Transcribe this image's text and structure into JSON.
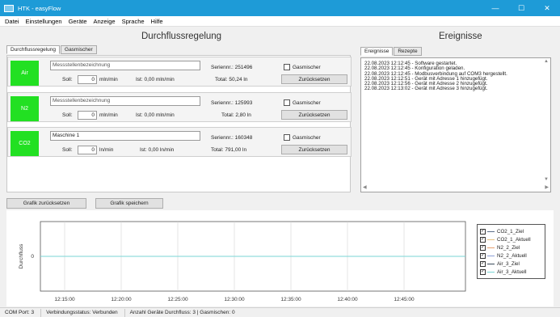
{
  "window": {
    "title": "HTK - easyFlow",
    "icon": "app-icon",
    "minimize_glyph": "—",
    "maximize_glyph": "☐",
    "close_glyph": "✕"
  },
  "menu": [
    "Datei",
    "Einstellungen",
    "Geräte",
    "Anzeige",
    "Sprache",
    "Hilfe"
  ],
  "flow": {
    "title": "Durchflussregelung",
    "tabs": [
      {
        "label": "Durchflussregelung",
        "active": true
      },
      {
        "label": "Gasmischer",
        "active": false
      }
    ],
    "devices": [
      {
        "name": "Air",
        "placeholder": "Messstellenbezeichnung",
        "soll_label": "Soll:",
        "soll_value": "0",
        "soll_unit": "mln/min",
        "ist": "Ist: 0,00 mln/min",
        "serial": "Seriennr.: 251496",
        "gasmischer": "Gasmischer",
        "total": "Total: 50,24 ln",
        "reset": "Zurücksetzen",
        "color": "#22e022"
      },
      {
        "name": "N2",
        "placeholder": "Messstellenbezeichnung",
        "soll_label": "Soll:",
        "soll_value": "0",
        "soll_unit": "mln/min",
        "ist": "Ist: 0,00 mln/min",
        "serial": "Seriennr.: 125993",
        "gasmischer": "Gasmischer",
        "total": "Total: 2,80 ln",
        "reset": "Zurücksetzen",
        "color": "#22e022"
      },
      {
        "name": "CO2",
        "placeholder": "Maschine 1",
        "soll_label": "Soll:",
        "soll_value": "0",
        "soll_unit": "ln/min",
        "ist": "Ist: 0,00 ln/min",
        "serial": "Seriennr.: 160348",
        "gasmischer": "Gasmischer",
        "total": "Total: 791,00 ln",
        "reset": "Zurücksetzen",
        "color": "#22e022"
      }
    ]
  },
  "events": {
    "title": "Ereignisse",
    "tabs": [
      {
        "label": "Ereignisse",
        "active": true
      },
      {
        "label": "Rezepte",
        "active": false
      }
    ],
    "lines": [
      "22.08.2023 12:12:45 - Software gestartet.",
      "22.08.2023 12:12:45 - Konfiguration geladen.",
      "22.08.2023 12:12:45 - Modbusverbindung auf COM3 hergestellt.",
      "22.08.2023 12:12:51 - Gerät mit Adresse 1 hinzugefügt.",
      "22.08.2023 12:12:56 - Gerät mit Adresse 2 hinzugefügt.",
      "22.08.2023 12:13:02 - Gerät mit Adresse 3 hinzugefügt."
    ]
  },
  "graph_buttons": {
    "reset": "Grafik zurücksetzen",
    "save": "Grafik speichern"
  },
  "chart_data": {
    "type": "line",
    "ylabel": "Durchfluss",
    "yticks": [
      "0"
    ],
    "xticks": [
      "12:15:00",
      "12:20:00",
      "12:25:00",
      "12:30:00",
      "12:35:00",
      "12:40:00",
      "12:45:00"
    ],
    "series": [
      {
        "name": "CO2_1_Ziel",
        "color": "#5b6f8a",
        "values": [
          0,
          0,
          0,
          0,
          0,
          0,
          0
        ]
      },
      {
        "name": "CO2_1_Aktuell",
        "color": "#e6c280",
        "values": [
          0,
          0,
          0,
          0,
          0,
          0,
          0
        ]
      },
      {
        "name": "N2_2_Ziel",
        "color": "#e7a070",
        "values": [
          0,
          0,
          0,
          0,
          0,
          0,
          0
        ]
      },
      {
        "name": "N2_2_Aktuell",
        "color": "#8b9fd6",
        "values": [
          0,
          0,
          0,
          0,
          0,
          0,
          0
        ]
      },
      {
        "name": "Air_3_Ziel",
        "color": "#3a4a5a",
        "values": [
          0,
          0,
          0,
          0,
          0,
          0,
          0
        ]
      },
      {
        "name": "Air_3_Aktuell",
        "color": "#7ad6d6",
        "values": [
          0,
          0,
          0,
          0,
          0,
          0,
          0
        ]
      }
    ]
  },
  "legend_check": "✓",
  "status": [
    "COM Port: 3",
    "Verbindungsstatus: Verbunden",
    "Anzahl Geräte Durchfluss: 3 | Gasmischen: 0"
  ]
}
